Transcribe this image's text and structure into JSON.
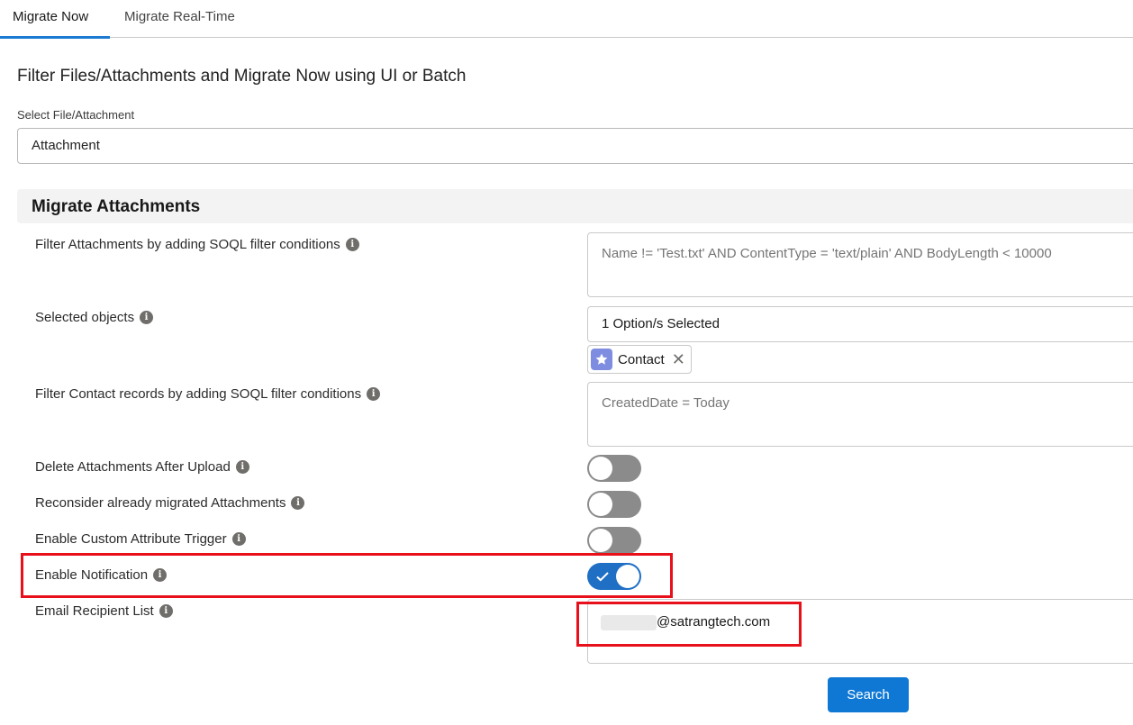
{
  "tabs": [
    {
      "label": "Migrate Now",
      "active": true
    },
    {
      "label": "Migrate Real-Time",
      "active": false
    }
  ],
  "page_title": "Filter Files/Attachments and Migrate Now using UI or Batch",
  "file_select": {
    "label": "Select File/Attachment",
    "value": "Attachment"
  },
  "section": {
    "title": "Migrate Attachments"
  },
  "fields": {
    "filter_attachments": {
      "label": "Filter Attachments by adding SOQL filter conditions",
      "placeholder": "Name != 'Test.txt' AND ContentType = 'text/plain' AND BodyLength < 10000"
    },
    "selected_objects": {
      "label": "Selected objects",
      "value": "1 Option/s Selected",
      "pills": [
        {
          "label": "Contact",
          "icon": "star-icon",
          "icon_color": "#7f8de1"
        }
      ]
    },
    "filter_contact": {
      "label": "Filter Contact records by adding SOQL filter conditions",
      "placeholder": "CreatedDate = Today"
    },
    "delete_after_upload": {
      "label": "Delete Attachments After Upload",
      "enabled": false
    },
    "reconsider_migrated": {
      "label": "Reconsider already migrated Attachments",
      "enabled": false
    },
    "custom_attribute_trigger": {
      "label": "Enable Custom Attribute Trigger",
      "enabled": false
    },
    "enable_notification": {
      "label": "Enable Notification",
      "enabled": true
    },
    "email_recipients": {
      "label": "Email Recipient List",
      "value": "@satrangtech.com"
    }
  },
  "search_button": "Search",
  "colors": {
    "accent": "#1f6fc4",
    "button": "#0f78d4",
    "highlight": "#e8101a",
    "toggle_off": "#8b8b8b"
  }
}
